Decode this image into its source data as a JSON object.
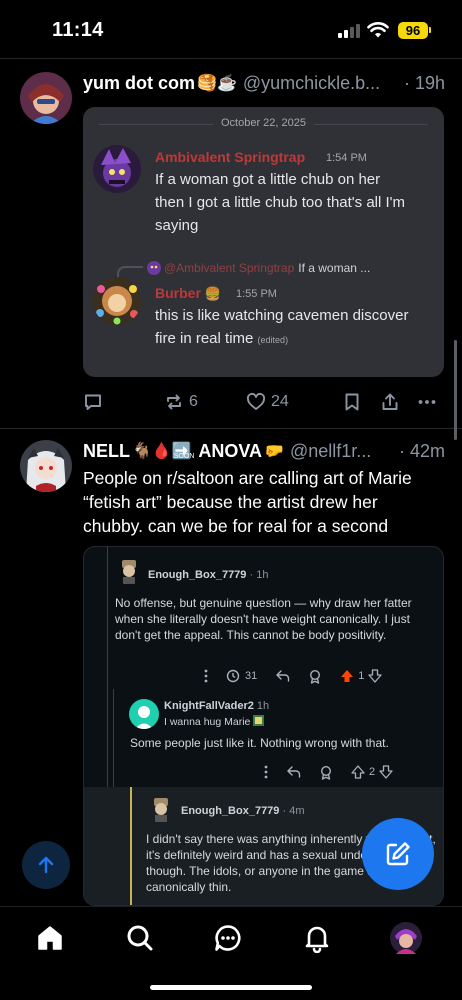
{
  "status_bar": {
    "time": "11:14",
    "battery": "96"
  },
  "post1": {
    "display_name": "yum dot com",
    "name_emoji": "🥞☕",
    "handle": "@yumchickle.b...",
    "time": "· 19h",
    "embed": {
      "date": "October 22, 2025",
      "msg1": {
        "author": "Ambivalent Springtrap",
        "time": "1:54 PM",
        "text": "If a woman got a little chub on her then I got a little chub too that's all I'm saying"
      },
      "reply_ref": {
        "mention": "@Ambivalent Springtrap",
        "snippet": "If a woman ..."
      },
      "msg2": {
        "author": "Burber",
        "author_emoji": "🍔",
        "time": "1:55 PM",
        "text": "this is like watching cavemen discover fire in real time",
        "edited": "(edited)"
      }
    },
    "actions": {
      "reposts": "6",
      "likes": "24"
    }
  },
  "post2": {
    "display_name": "NELL",
    "name_emoji": "🐐🩸➡️",
    "soon": "SOON",
    "name_rest": "ANOVA",
    "name_emoji2": "🤛",
    "handle": "@nellf1r...",
    "time": "· 42m",
    "text": "People on r/saltoon are calling art of Marie “fetish art” because the artist drew her chubby. can we be for real for a second",
    "embed": {
      "c1": {
        "user": "Enough_Box_7779",
        "meta": "· 1h",
        "body": "No offense, but genuine question — why draw her fatter when she literally doesn't have weight canonically. I just don't get the appeal. This cannot be body positivity.",
        "awards": "31",
        "votes": "1"
      },
      "c2": {
        "user": "KnightFallVader2",
        "meta": "1h",
        "flair": "I wanna hug Marie",
        "body": "Some people just like it. Nothing wrong with that.",
        "votes": "2"
      },
      "c3": {
        "user": "Enough_Box_7779",
        "meta": "· 4m",
        "body": "I didn't say there was anything inherently wrong with it, it's definitely weird and has a sexual undertone though. The idols, or anyone in the game are canonically thin."
      }
    }
  },
  "colors": {
    "accent": "#1d78f0",
    "background": "#000000",
    "muted": "#8c96a3",
    "upvote_active": "#ff4500"
  }
}
